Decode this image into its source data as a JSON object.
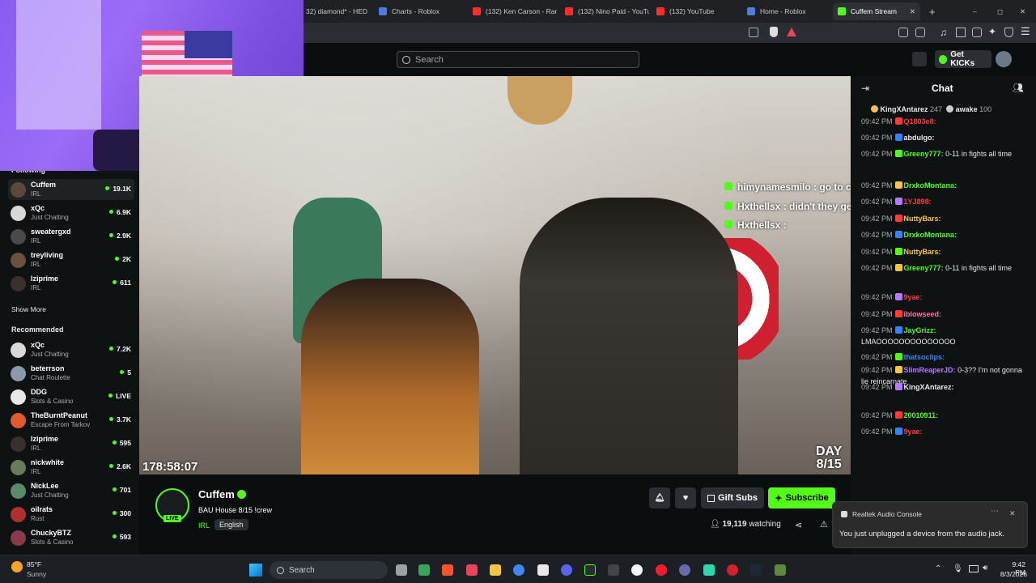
{
  "browser": {
    "tabs": [
      {
        "label": "32) diamond* - HED",
        "color": "#9aa0a6"
      },
      {
        "label": "Charts - Roblox",
        "color": "#4f7bd9"
      },
      {
        "label": "(132) Ken Carson - Ran",
        "color": "#ff2d2d"
      },
      {
        "label": "(132) Nino Paid - YouTu",
        "color": "#ff2d2d"
      },
      {
        "label": "(132) YouTube",
        "color": "#ff2d2d"
      },
      {
        "label": "Home - Roblox",
        "color": "#4f7bd9"
      },
      {
        "label": "Cuffem Stream",
        "color": "#53fc18"
      }
    ],
    "window_controls": [
      "–",
      "◻",
      "✕"
    ]
  },
  "site": {
    "search_placeholder": "Search",
    "get_kicks_label": "Get KICKs",
    "accent": "#53fc18"
  },
  "sidebar": {
    "following_label": "Following",
    "following": [
      {
        "name": "Cuffem",
        "category": "IRL",
        "viewers": "19.1K"
      },
      {
        "name": "xQc",
        "category": "Just Chatting",
        "viewers": "6.9K"
      },
      {
        "name": "sweatergxd",
        "category": "IRL",
        "viewers": "2.9K"
      },
      {
        "name": "treyliving",
        "category": "IRL",
        "viewers": "2K"
      },
      {
        "name": "lziprime",
        "category": "IRL",
        "viewers": "611"
      }
    ],
    "show_more_label": "Show More",
    "recommended_label": "Recommended",
    "recommended": [
      {
        "name": "xQc",
        "category": "Just Chatting",
        "viewers": "7.2K"
      },
      {
        "name": "beterrson",
        "category": "Chat Roulette",
        "viewers": "5"
      },
      {
        "name": "DDG",
        "category": "Slots & Casino",
        "viewers": "LIVE"
      },
      {
        "name": "TheBurntPeanut",
        "category": "Escape From Tarkov",
        "viewers": "3.7K"
      },
      {
        "name": "lziprime",
        "category": "IRL",
        "viewers": "595"
      },
      {
        "name": "nickwhite",
        "category": "IRL",
        "viewers": "2.6K"
      },
      {
        "name": "NickLee",
        "category": "Just Chatting",
        "viewers": "701"
      },
      {
        "name": "oilrats",
        "category": "Rust",
        "viewers": "300"
      },
      {
        "name": "ChuckyBTZ",
        "category": "Slots & Casino",
        "viewers": "593"
      }
    ]
  },
  "video": {
    "timer": "178:58:07",
    "day_label": "DAY",
    "day_value": "8/15",
    "overlay_chat": [
      {
        "text": "himynamesmilo : go to cuffem cam",
        "user_color": "#ffffff"
      },
      {
        "text": "Hxthellsx : didn't they get swatted???",
        "user_color": "#ff3b3b"
      },
      {
        "text": "Hxthellsx :",
        "user_color": "#ff3b3b"
      }
    ]
  },
  "channel": {
    "name": "Cuffem",
    "live_label": "LIVE",
    "title": "BAU House 8/15 !crew",
    "category": "IRL",
    "language": "English",
    "watching_count": "19,119",
    "watching_label": "watching",
    "gift_subs_label": "Gift Subs",
    "subscribe_label": "Subscribe"
  },
  "chat": {
    "title": "Chat",
    "top_gifters": [
      {
        "name": "KingXAntarez",
        "count": "247"
      },
      {
        "name": "awake",
        "count": "100"
      }
    ],
    "messages": [
      {
        "time": "09:42 PM",
        "user": "Q1803e8:",
        "text": "",
        "color": "#ff3b3b"
      },
      {
        "time": "09:42 PM",
        "user": "abdulgo:",
        "text": "",
        "color": "#e8e8e8"
      },
      {
        "time": "09:42 PM",
        "user": "Greeny777:",
        "text": "0-11 in fights all time",
        "color": "#53fc18"
      },
      {
        "time": "09:42 PM",
        "user": "DrxkoMontana:",
        "text": "",
        "color": "#53fc18"
      },
      {
        "time": "09:42 PM",
        "user": "1YJ898:",
        "text": "",
        "color": "#ff3b3b"
      },
      {
        "time": "09:42 PM",
        "user": "NuttyBars:",
        "text": "",
        "color": "#f5c542"
      },
      {
        "time": "09:42 PM",
        "user": "DrxkoMontana:",
        "text": "",
        "color": "#53fc18"
      },
      {
        "time": "09:42 PM",
        "user": "NuttyBars:",
        "text": "",
        "color": "#f5c542"
      },
      {
        "time": "09:42 PM",
        "user": "Greeny777:",
        "text": "0-11 in fights all time",
        "color": "#53fc18"
      },
      {
        "time": "09:42 PM",
        "user": "9yae:",
        "text": "",
        "color": "#ff3b3b"
      },
      {
        "time": "09:42 PM",
        "user": "iblowseed:",
        "text": "",
        "color": "#ff6fa8"
      },
      {
        "time": "09:42 PM",
        "user": "JayGrizz:",
        "text": "LMAOOOOOOOOOOOOOO",
        "color": "#53fc18"
      },
      {
        "time": "09:42 PM",
        "user": "thatsoclips:",
        "text": "",
        "color": "#3b82f6"
      },
      {
        "time": "09:42 PM",
        "user": "SlimReaperJD:",
        "text": "0-3?? I'm not gonna lie reincarnate",
        "color": "#b57bff"
      },
      {
        "time": "09:42 PM",
        "user": "KingXAntarez:",
        "text": "",
        "color": "#e8e8e8"
      },
      {
        "time": "09:42 PM",
        "user": "20010911:",
        "text": "",
        "color": "#53fc18"
      },
      {
        "time": "09:42 PM",
        "user": "9yae:",
        "text": "",
        "color": "#ff3b3b"
      }
    ]
  },
  "toast": {
    "app": "Realtek Audio Console",
    "message": "You just unplugged a device from the audio jack."
  },
  "taskbar": {
    "weather_temp": "85°F",
    "weather_desc": "Sunny",
    "search_label": "Search",
    "time": "9:42 PM",
    "date": "8/3/2026"
  }
}
